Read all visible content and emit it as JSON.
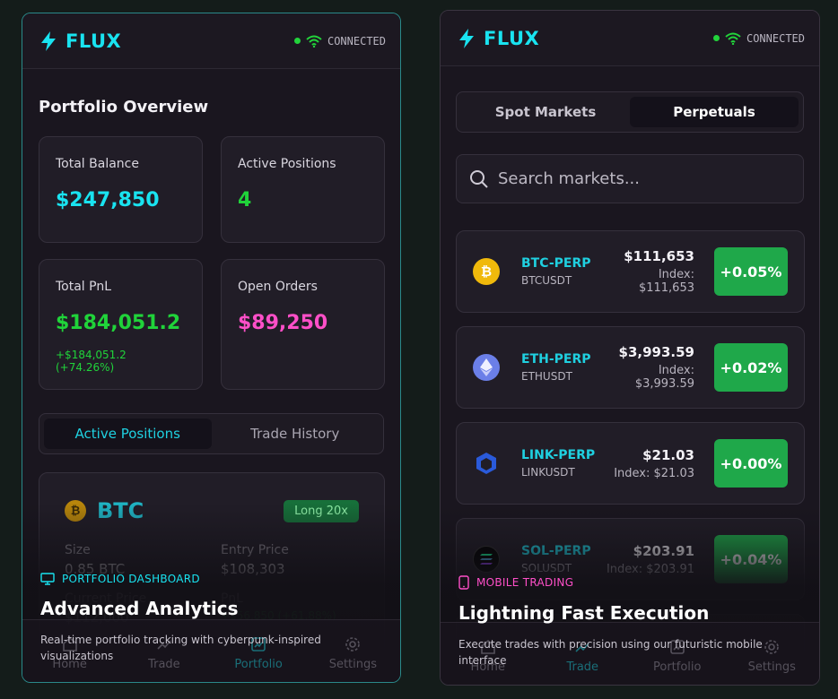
{
  "left": {
    "brand": "FLUX",
    "status": "CONNECTED",
    "section_title": "Portfolio Overview",
    "stats": {
      "total_balance": {
        "label": "Total Balance",
        "value": "$247,850"
      },
      "active_positions": {
        "label": "Active Positions",
        "value": "4"
      },
      "total_pnl": {
        "label": "Total PnL",
        "value": "$184,051.2",
        "sub": "+$184,051.2 (+74.26%)"
      },
      "open_orders": {
        "label": "Open Orders",
        "value": "$89,250"
      }
    },
    "tabs": [
      "Active Positions",
      "Trade History"
    ],
    "position": {
      "symbol": "BTC",
      "badge": "Long 20x",
      "size_label": "Size",
      "size_value": "0.85 BTC",
      "entry_label": "Entry Price",
      "entry_value": "$108,303",
      "current_label": "Current Price",
      "current_value": "$112,000",
      "pnl_label": "PnL",
      "pnl_value": "+$56,850 (+61.88%)"
    },
    "nav": [
      "Home",
      "Trade",
      "Portfolio",
      "Settings"
    ],
    "caption": {
      "tag": "PORTFOLIO DASHBOARD",
      "title": "Advanced Analytics",
      "desc": "Real-time portfolio tracking with cyberpunk-inspired visualizations"
    }
  },
  "right": {
    "brand": "FLUX",
    "status": "CONNECTED",
    "tabs": [
      "Spot Markets",
      "Perpetuals"
    ],
    "search_placeholder": "Search markets...",
    "markets": [
      {
        "symbol": "BTC-PERP",
        "pair": "BTCUSDT",
        "price": "$111,653",
        "index": "Index: $111,653",
        "change": "+0.05%"
      },
      {
        "symbol": "ETH-PERP",
        "pair": "ETHUSDT",
        "price": "$3,993.59",
        "index": "Index: $3,993.59",
        "change": "+0.02%"
      },
      {
        "symbol": "LINK-PERP",
        "pair": "LINKUSDT",
        "price": "$21.03",
        "index": "Index: $21.03",
        "change": "+0.00%"
      },
      {
        "symbol": "SOL-PERP",
        "pair": "SOLUSDT",
        "price": "$203.91",
        "index": "Index: $203.91",
        "change": "+0.04%"
      }
    ],
    "nav": [
      "Home",
      "Trade",
      "Portfolio",
      "Settings"
    ],
    "caption": {
      "tag": "MOBILE TRADING",
      "title": "Lightning Fast Execution",
      "desc": "Execute trades with precision using our futuristic mobile interface"
    }
  },
  "colors": {
    "accent": "#19e3f0",
    "green": "#20d33a",
    "pink": "#ff4fc8",
    "positive_chip": "#1fa84a"
  }
}
